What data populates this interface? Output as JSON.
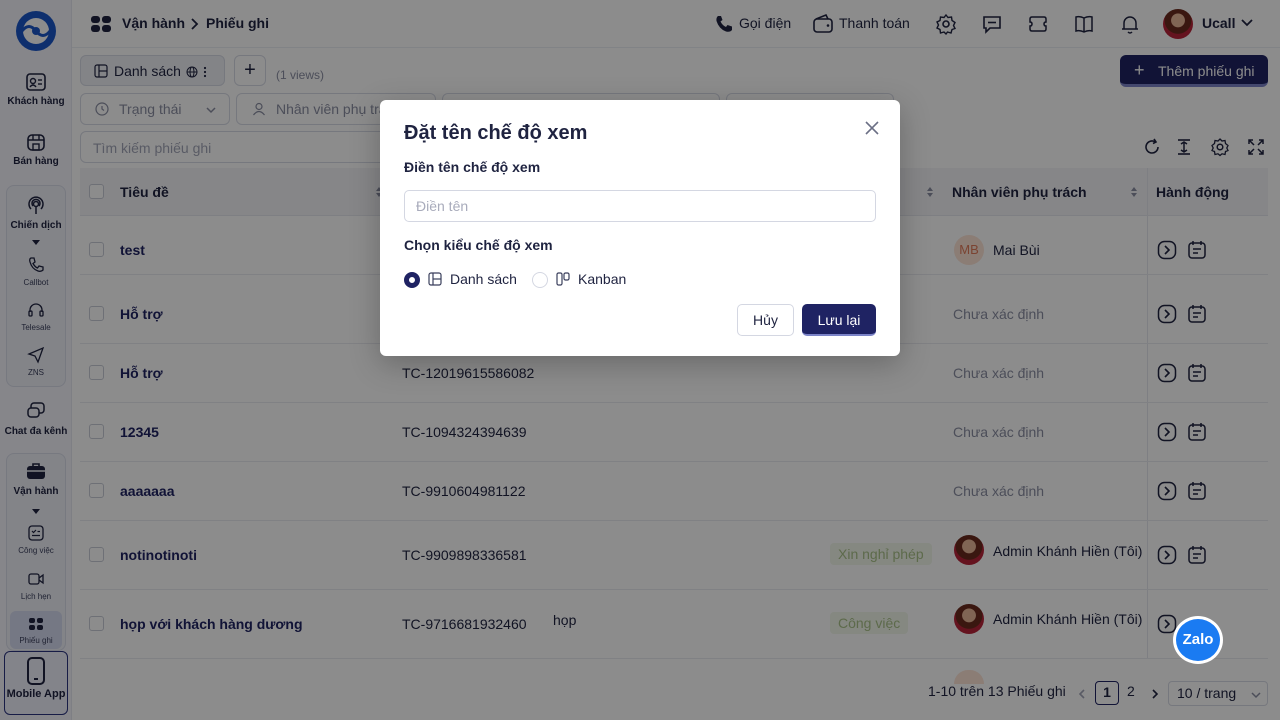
{
  "sidebar": {
    "items": [
      {
        "label": "Khách hàng",
        "icon": "contact-card-icon"
      },
      {
        "label": "Bán hàng",
        "icon": "store-icon"
      },
      {
        "label": "Chiến dịch",
        "icon": "broadcast-icon"
      },
      {
        "label": "Callbot",
        "icon": "phone-icon"
      },
      {
        "label": "Telesale",
        "icon": "headset-icon"
      },
      {
        "label": "ZNS",
        "icon": "send-icon"
      },
      {
        "label": "Chat đa kênh",
        "icon": "chat-icon"
      },
      {
        "label": "Vận hành",
        "icon": "briefcase-icon"
      },
      {
        "label": "Công việc",
        "icon": "task-icon"
      },
      {
        "label": "Lịch hẹn",
        "icon": "calendar-video-icon"
      },
      {
        "label": "Phiếu ghi",
        "icon": "ticket-icon"
      }
    ],
    "mobile_app": "Mobile App"
  },
  "header": {
    "breadcrumb_root": "Vận hành",
    "breadcrumb_current": "Phiếu ghi",
    "call_label": "Gọi điện",
    "payment_label": "Thanh toán",
    "user_name": "Ucall"
  },
  "toolbar": {
    "view_tab": "Danh sách",
    "add_view": "+",
    "views_count": "(1 views)",
    "add_button": "Thêm phiếu ghi",
    "filter_status": "Trạng thái",
    "filter_assignee": "Nhân viên phụ trách",
    "search_placeholder": "Tìm kiếm phiếu ghi"
  },
  "table": {
    "headers": {
      "title": "Tiêu đề",
      "assignee": "Nhân viên phụ trách",
      "actions": "Hành động"
    },
    "rows": [
      {
        "title": "test",
        "code": "",
        "desc": "",
        "tag": "",
        "assignee": "Mai Bùi",
        "avatar": "MB"
      },
      {
        "title": "Hỗ trợ",
        "code": "",
        "desc": "",
        "tag": "",
        "assignee": "Chưa xác định",
        "avatar": ""
      },
      {
        "title": "Hỗ trợ",
        "code": "TC-12019615586082",
        "desc": "",
        "tag": "",
        "assignee": "Chưa xác định",
        "avatar": ""
      },
      {
        "title": "12345",
        "code": "TC-1094324394639",
        "desc": "",
        "tag": "",
        "assignee": "Chưa xác định",
        "avatar": ""
      },
      {
        "title": "aaaaaaa",
        "code": "TC-9910604981122",
        "desc": "",
        "tag": "",
        "assignee": "Chưa xác định",
        "avatar": ""
      },
      {
        "title": "notinotinoti",
        "code": "TC-9909898336581",
        "desc": "",
        "tag": "Xin nghỉ phép",
        "assignee": "Admin Khánh Hiền (Tôi)",
        "avatar": "photo"
      },
      {
        "title": "họp với khách hàng dương",
        "code": "TC-9716681932460",
        "desc": "họp",
        "tag": "Công việc",
        "assignee": "Admin Khánh Hiền (Tôi)",
        "avatar": "photo"
      }
    ]
  },
  "pagination": {
    "summary": "1-10 trên 13 Phiếu ghi",
    "current_page": "1",
    "next_page": "2",
    "page_size": "10 / trang"
  },
  "modal": {
    "title": "Đặt tên chế độ xem",
    "name_label": "Điền tên chế độ xem",
    "name_placeholder": "Điền tên",
    "type_label": "Chọn kiểu chế độ xem",
    "option_list": "Danh sách",
    "option_kanban": "Kanban",
    "selected_option": "Danh sách",
    "cancel": "Hủy",
    "save": "Lưu lại"
  },
  "zalo": {
    "label": "Zalo"
  },
  "colors": {
    "primary": "#1f2363",
    "tag_bg": "#f2f7ec",
    "tag_text": "#a9c289",
    "zalo": "#1a7bf2"
  }
}
